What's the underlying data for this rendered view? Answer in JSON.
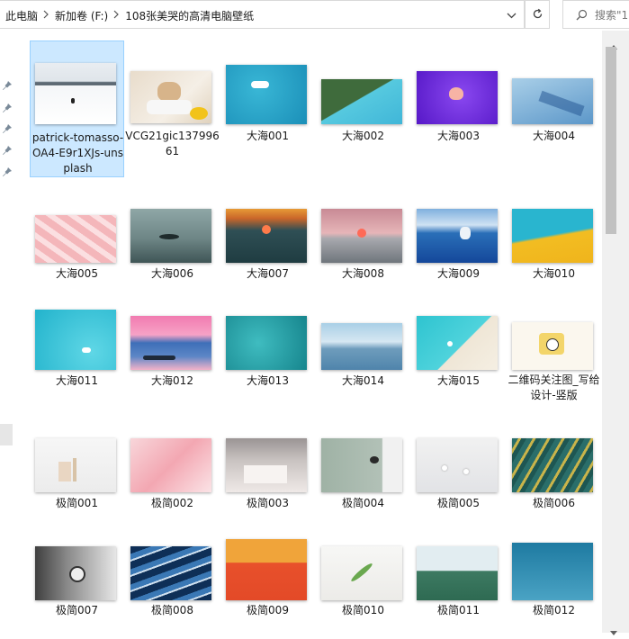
{
  "breadcrumb": {
    "items": [
      "此电脑",
      "新加卷 (F:)",
      "108张美哭的高清电脑壁纸"
    ]
  },
  "search": {
    "placeholder": "搜索\"1"
  },
  "icons": {
    "separator": "chevron-right-icon",
    "dropdown": "chevron-down-icon",
    "refresh": "refresh-icon",
    "search": "search-icon",
    "pin": "pin-icon"
  },
  "files": [
    {
      "name": "patrick-tomasso-OA4-E9r1XJs-unsplash",
      "selected": true
    },
    {
      "name": "VCG21gic13799661"
    },
    {
      "name": "大海001"
    },
    {
      "name": "大海002"
    },
    {
      "name": "大海003"
    },
    {
      "name": "大海004"
    },
    {
      "name": "大海005"
    },
    {
      "name": "大海006"
    },
    {
      "name": "大海007"
    },
    {
      "name": "大海008"
    },
    {
      "name": "大海009"
    },
    {
      "name": "大海010"
    },
    {
      "name": "大海011"
    },
    {
      "name": "大海012"
    },
    {
      "name": "大海013"
    },
    {
      "name": "大海014"
    },
    {
      "name": "大海015"
    },
    {
      "name": "二维码关注图_写给设计-竖版"
    },
    {
      "name": "极简001"
    },
    {
      "name": "极简002"
    },
    {
      "name": "极简003"
    },
    {
      "name": "极简004"
    },
    {
      "name": "极简005"
    },
    {
      "name": "极简006"
    },
    {
      "name": "极简007"
    },
    {
      "name": "极简008"
    },
    {
      "name": "极简009"
    },
    {
      "name": "极简010"
    },
    {
      "name": "极简011"
    },
    {
      "name": "极简012"
    }
  ],
  "colors": {
    "selection_bg": "#cce8ff",
    "selection_border": "#99d1ff",
    "scrollbar_thumb": "#c1c1c1"
  }
}
